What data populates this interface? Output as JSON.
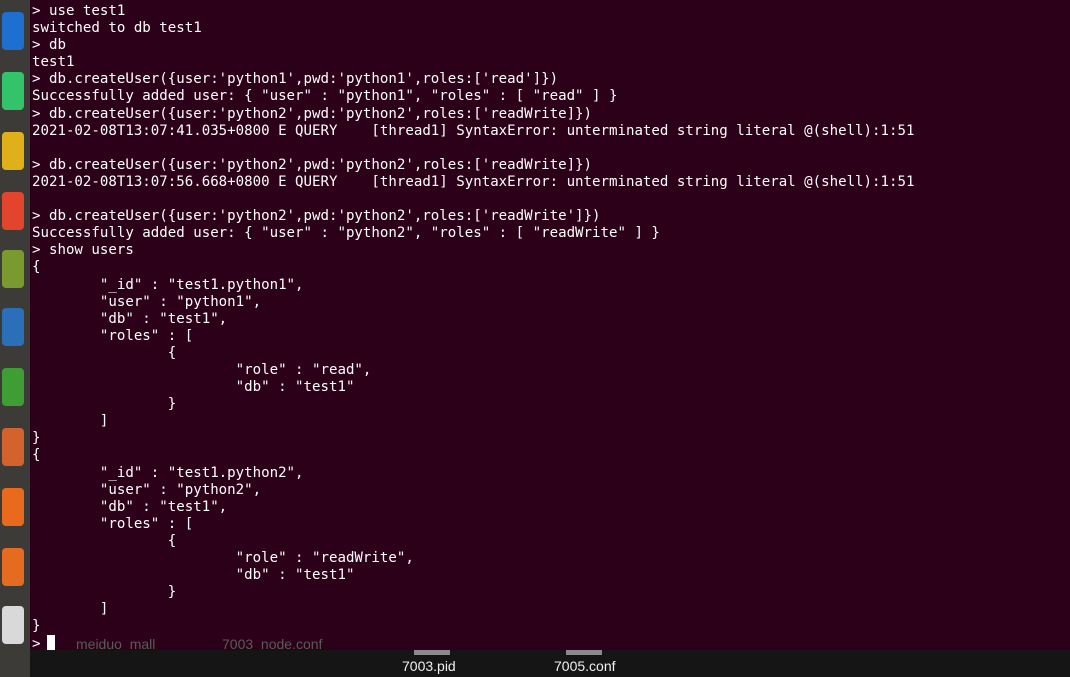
{
  "launcher": {
    "items": [
      {
        "name": "vscode-icon",
        "color": "#1f6fd0"
      },
      {
        "name": "pycharm-icon",
        "color": "#33c469"
      },
      {
        "name": "chrome-icon",
        "color": "#e0b01a"
      },
      {
        "name": "tool-icon",
        "color": "#e2442c"
      },
      {
        "name": "book-icon",
        "color": "#7a9a2f"
      },
      {
        "name": "writer-doc-icon",
        "color": "#2a6fb8"
      },
      {
        "name": "calc-sheet-icon",
        "color": "#3e9d33"
      },
      {
        "name": "impress-icon",
        "color": "#d4622c"
      },
      {
        "name": "firefox-icon",
        "color": "#e96a1c"
      },
      {
        "name": "software-center-icon",
        "color": "#e46b1f"
      },
      {
        "name": "amazon-icon",
        "color": "#d9d9d9"
      }
    ]
  },
  "terminal": {
    "lines": [
      "> use test1",
      "switched to db test1",
      "> db",
      "test1",
      "> db.createUser({user:'python1',pwd:'python1',roles:['read']})",
      "Successfully added user: { \"user\" : \"python1\", \"roles\" : [ \"read\" ] }",
      "> db.createUser({user:'python2',pwd:'python2',roles:['readWrite]})",
      "2021-02-08T13:07:41.035+0800 E QUERY    [thread1] SyntaxError: unterminated string literal @(shell):1:51",
      "",
      "> db.createUser({user:'python2',pwd:'python2',roles:['readWrite]})",
      "2021-02-08T13:07:56.668+0800 E QUERY    [thread1] SyntaxError: unterminated string literal @(shell):1:51",
      "",
      "> db.createUser({user:'python2',pwd:'python2',roles:['readWrite']})",
      "Successfully added user: { \"user\" : \"python2\", \"roles\" : [ \"readWrite\" ] }",
      "> show users",
      "{",
      "        \"_id\" : \"test1.python1\",",
      "        \"user\" : \"python1\",",
      "        \"db\" : \"test1\",",
      "        \"roles\" : [",
      "                {",
      "                        \"role\" : \"read\",",
      "                        \"db\" : \"test1\"",
      "                }",
      "        ]",
      "}",
      "{",
      "        \"_id\" : \"test1.python2\",",
      "        \"user\" : \"python2\",",
      "        \"db\" : \"test1\",",
      "        \"roles\" : [",
      "                {",
      "                        \"role\" : \"readWrite\",",
      "                        \"db\" : \"test1\"",
      "                }",
      "        ]",
      "}"
    ],
    "prompt": ">",
    "background_color": "#2c0018",
    "text_color": "#ffffff"
  },
  "desktop": {
    "files": [
      {
        "name": "7003.pid"
      },
      {
        "name": "7005.conf"
      }
    ],
    "hidden_files": [
      "meiduo_mall",
      "7003_node.conf"
    ]
  }
}
